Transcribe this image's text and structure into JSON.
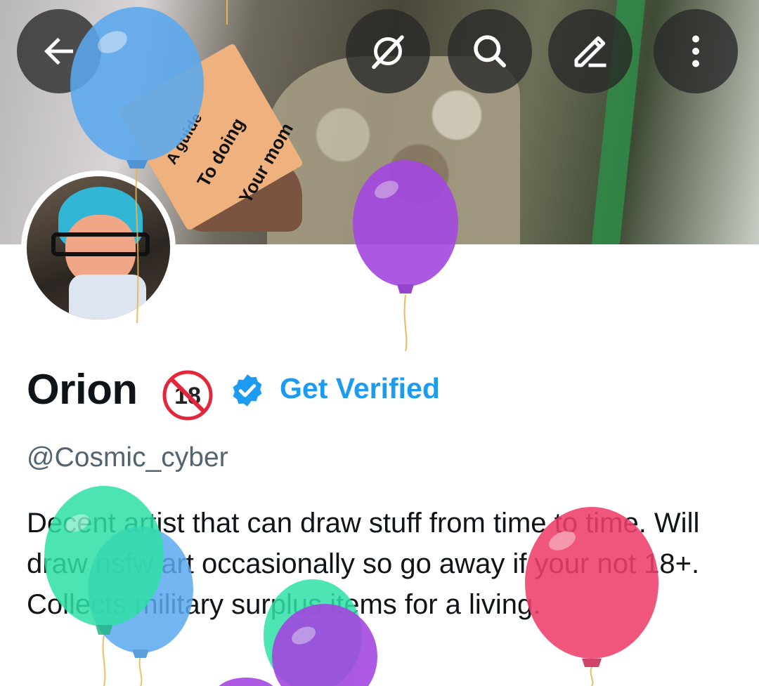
{
  "banner": {
    "card_lines": [
      "A guide",
      "To doing",
      "Your mom"
    ]
  },
  "toolbar": {
    "back_icon": "arrow-left-icon",
    "grok_icon": "grok-icon",
    "search_icon": "search-icon",
    "edit_icon": "pencil-icon",
    "more_icon": "more-vertical-icon"
  },
  "profile": {
    "display_name": "Orion",
    "age_badge_text": "18",
    "age_badge_icon": "no-under-18-icon",
    "verified_icon": "verified-badge-icon",
    "get_verified_label": "Get Verified",
    "handle": "@Cosmic_cyber",
    "bio": "Decent artist that can draw stuff from time to time. Will draw nsfw art occasionally so go away if your not 18+. Collects military surplus items for a living."
  },
  "colors": {
    "accent": "#1d9bf0",
    "text": "#0f1419",
    "secondary_text": "#536471",
    "balloon_blue": "#5aa9ee",
    "balloon_purple": "#a347e0",
    "balloon_green": "#2fe0a8",
    "balloon_red": "#ee3f6a"
  }
}
